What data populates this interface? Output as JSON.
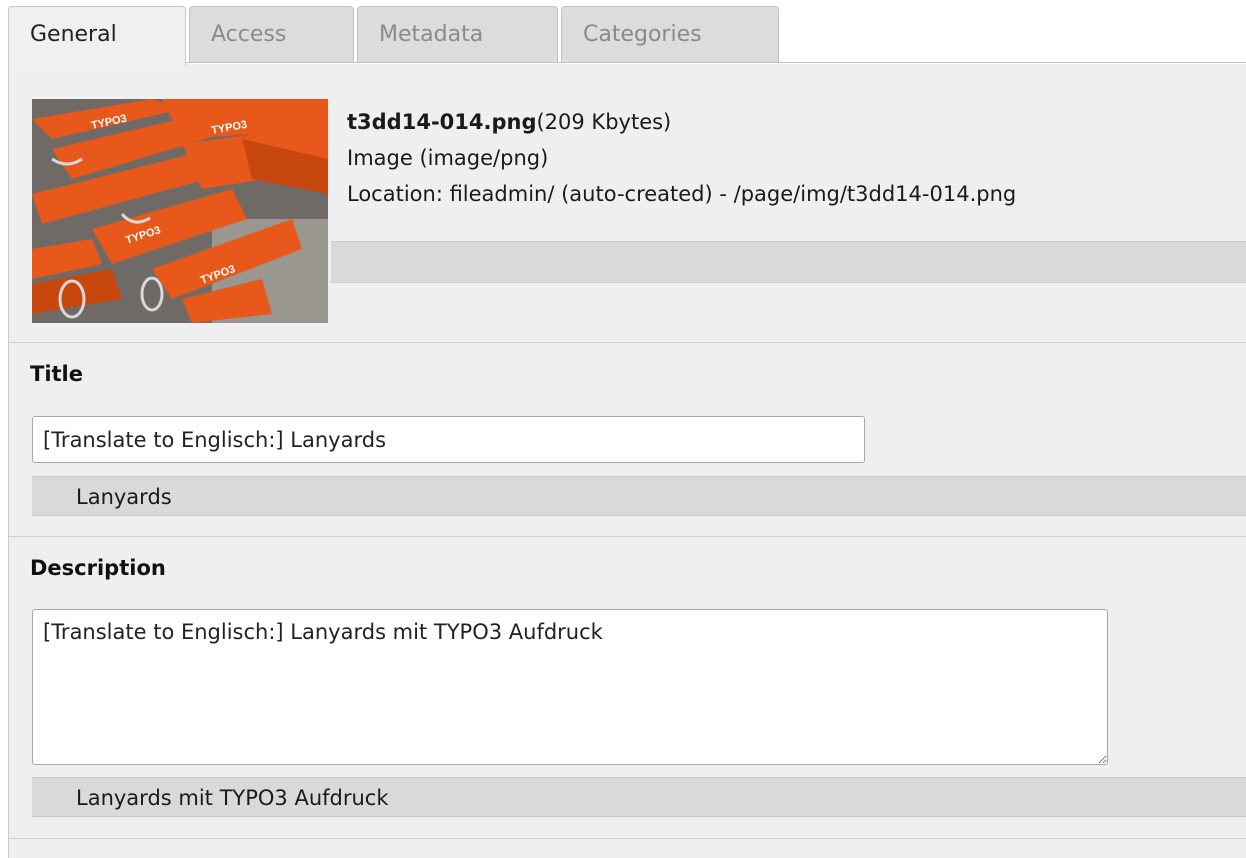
{
  "tabs": [
    {
      "label": "General",
      "active": true
    },
    {
      "label": "Access",
      "active": false
    },
    {
      "label": "Metadata",
      "active": false
    },
    {
      "label": "Categories",
      "active": false
    }
  ],
  "file": {
    "name": "t3dd14-014.png",
    "size": "(209 Kbytes)",
    "type": "Image (image/png)",
    "location": "Location: fileadmin/ (auto-created) - /page/img/t3dd14-014.png"
  },
  "fields": {
    "title": {
      "label": "Title",
      "value": "[Translate to Englisch:] Lanyards",
      "original": "Lanyards"
    },
    "description": {
      "label": "Description",
      "value": "[Translate to Englisch:] Lanyards mit TYPO3 Aufdruck",
      "original": "Lanyards mit TYPO3 Aufdruck"
    }
  },
  "colors": {
    "lanyard_orange": "#e8581a",
    "panel_bg": "#efefef",
    "original_bar": "#d9d9d9"
  }
}
